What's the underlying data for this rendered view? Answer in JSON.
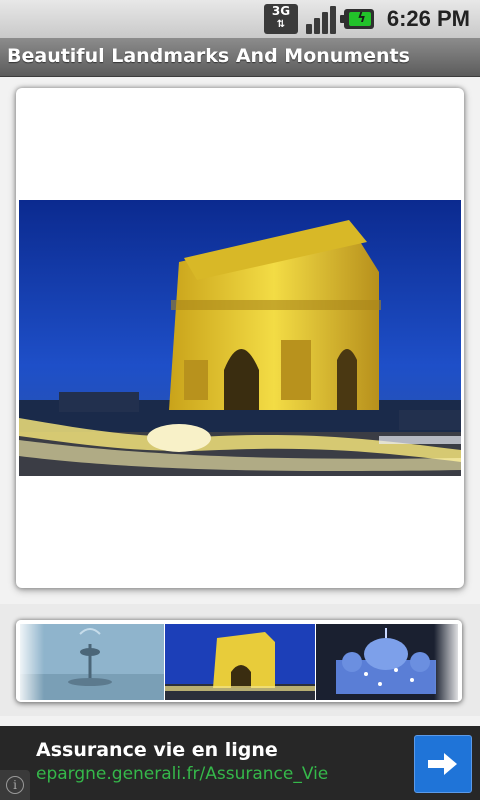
{
  "status_bar": {
    "network": "3G",
    "time": "6:26 PM",
    "icons": [
      "network-3g-icon",
      "signal-icon",
      "battery-charging-icon"
    ]
  },
  "app": {
    "title": "Beautiful Landmarks And Monuments"
  },
  "main_image": {
    "subject": "Arc de Triomphe"
  },
  "gallery": {
    "thumbnails": [
      {
        "subject": "fountain"
      },
      {
        "subject": "Arc de Triomphe"
      },
      {
        "subject": "illuminated cathedral"
      }
    ],
    "selected_index": 1
  },
  "ad": {
    "headline": "Assurance vie en ligne",
    "url": "epargne.generali.fr/Assurance_Vie",
    "go_icon": "arrow-right-icon",
    "info_icon": "info-icon",
    "colors": {
      "background": "#272727",
      "url": "#35b84a",
      "button": "#1f74d8"
    }
  }
}
